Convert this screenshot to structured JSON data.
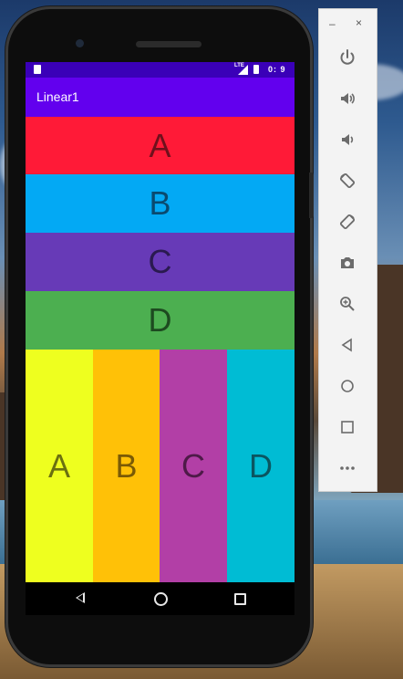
{
  "app": {
    "title": "Linear1"
  },
  "status_bar": {
    "time": "0: 9",
    "network": "LTE"
  },
  "rows": [
    {
      "label": "A",
      "color": "#ff1a37"
    },
    {
      "label": "B",
      "color": "#03a9f4"
    },
    {
      "label": "C",
      "color": "#673ab7"
    },
    {
      "label": "D",
      "color": "#4caf50"
    }
  ],
  "columns": [
    {
      "label": "A",
      "color": "#eeff1f"
    },
    {
      "label": "B",
      "color": "#ffc107"
    },
    {
      "label": "C",
      "color": "#b23fa6"
    },
    {
      "label": "D",
      "color": "#00bcd4"
    }
  ],
  "navigation": {
    "icons": [
      "back-icon",
      "home-icon",
      "recent-apps-icon"
    ]
  },
  "emulator_toolbar": {
    "window_buttons": {
      "minimize": "–",
      "close": "×"
    },
    "buttons": [
      {
        "name": "power-icon"
      },
      {
        "name": "volume-up-icon"
      },
      {
        "name": "volume-down-icon"
      },
      {
        "name": "rotate-left-icon"
      },
      {
        "name": "rotate-right-icon"
      },
      {
        "name": "camera-icon"
      },
      {
        "name": "zoom-icon"
      },
      {
        "name": "back-icon"
      },
      {
        "name": "home-icon"
      },
      {
        "name": "overview-icon"
      },
      {
        "name": "more-icon"
      }
    ]
  }
}
